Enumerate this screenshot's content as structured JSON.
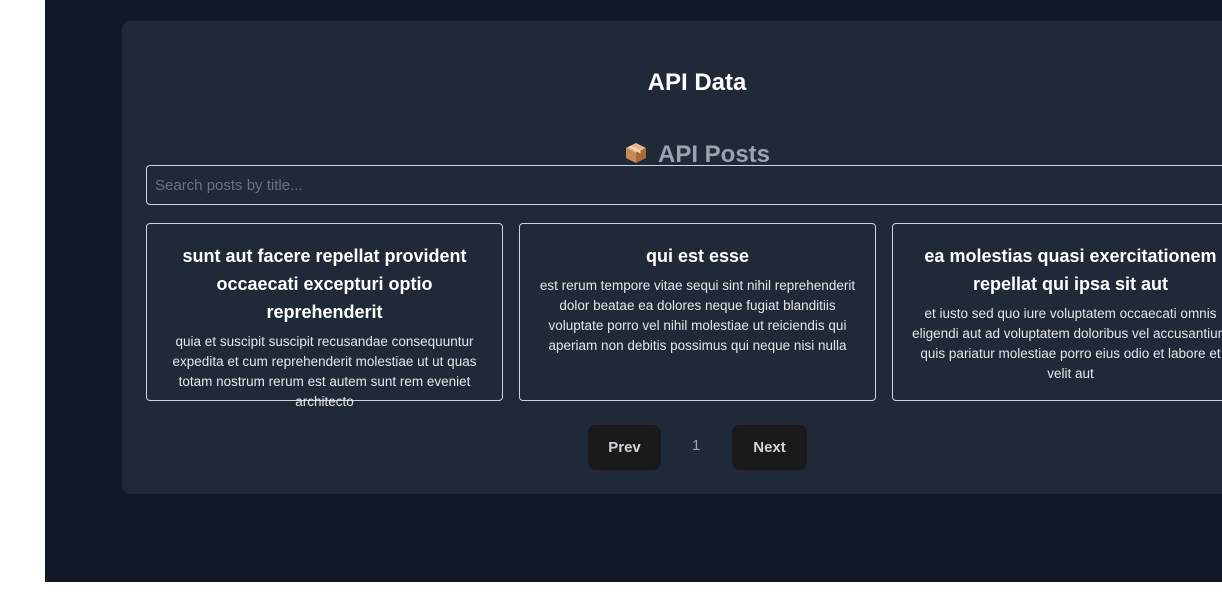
{
  "page": {
    "title": "API Data",
    "section_title": "API Posts",
    "section_icon": "package-icon"
  },
  "search": {
    "placeholder": "Search posts by title...",
    "value": ""
  },
  "posts": [
    {
      "title": "sunt aut facere repellat provident occaecati excepturi optio reprehenderit",
      "body": "quia et suscipit suscipit recusandae consequuntur expedita et cum reprehenderit molestiae ut ut quas totam nostrum rerum est autem sunt rem eveniet architecto"
    },
    {
      "title": "qui est esse",
      "body": "est rerum tempore vitae sequi sint nihil reprehenderit dolor beatae ea dolores neque fugiat blanditiis voluptate porro vel nihil molestiae ut reiciendis qui aperiam non debitis possimus qui neque nisi nulla"
    },
    {
      "title": "ea molestias quasi exercitationem repellat qui ipsa sit aut",
      "body": "et iusto sed quo iure voluptatem occaecati omnis eligendi aut ad voluptatem doloribus vel accusantium quis pariatur molestiae porro eius odio et labore et velit aut"
    }
  ],
  "pagination": {
    "prev_label": "Prev",
    "current_page": "1",
    "next_label": "Next"
  },
  "colors": {
    "app_background": "#111827",
    "panel_background": "#1f2937",
    "button_background": "#1a1a1a"
  }
}
